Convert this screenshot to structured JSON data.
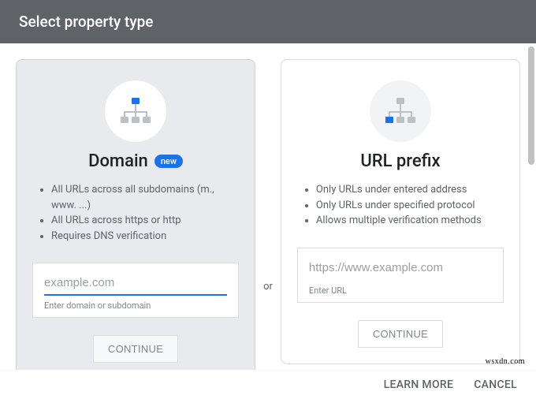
{
  "header": {
    "title": "Select property type"
  },
  "separator": "or",
  "domain": {
    "title": "Domain",
    "badge": "new",
    "features": [
      "All URLs across all subdomains (m., www. ...)",
      "All URLs across https or http",
      "Requires DNS verification"
    ],
    "placeholder": "example.com",
    "hint": "Enter domain or subdomain",
    "button": "CONTINUE",
    "icon": "sitemap-icon"
  },
  "urlprefix": {
    "title": "URL prefix",
    "features": [
      "Only URLs under entered address",
      "Only URLs under specified protocol",
      "Allows multiple verification methods"
    ],
    "placeholder": "https://www.example.com",
    "hint": "Enter URL",
    "button": "CONTINUE",
    "icon": "sitemap-icon"
  },
  "footer": {
    "learn_more": "LEARN MORE",
    "cancel": "CANCEL"
  },
  "watermark": "wsxdn.com",
  "colors": {
    "accent": "#1a73e8",
    "header_bg": "#5f6368"
  }
}
